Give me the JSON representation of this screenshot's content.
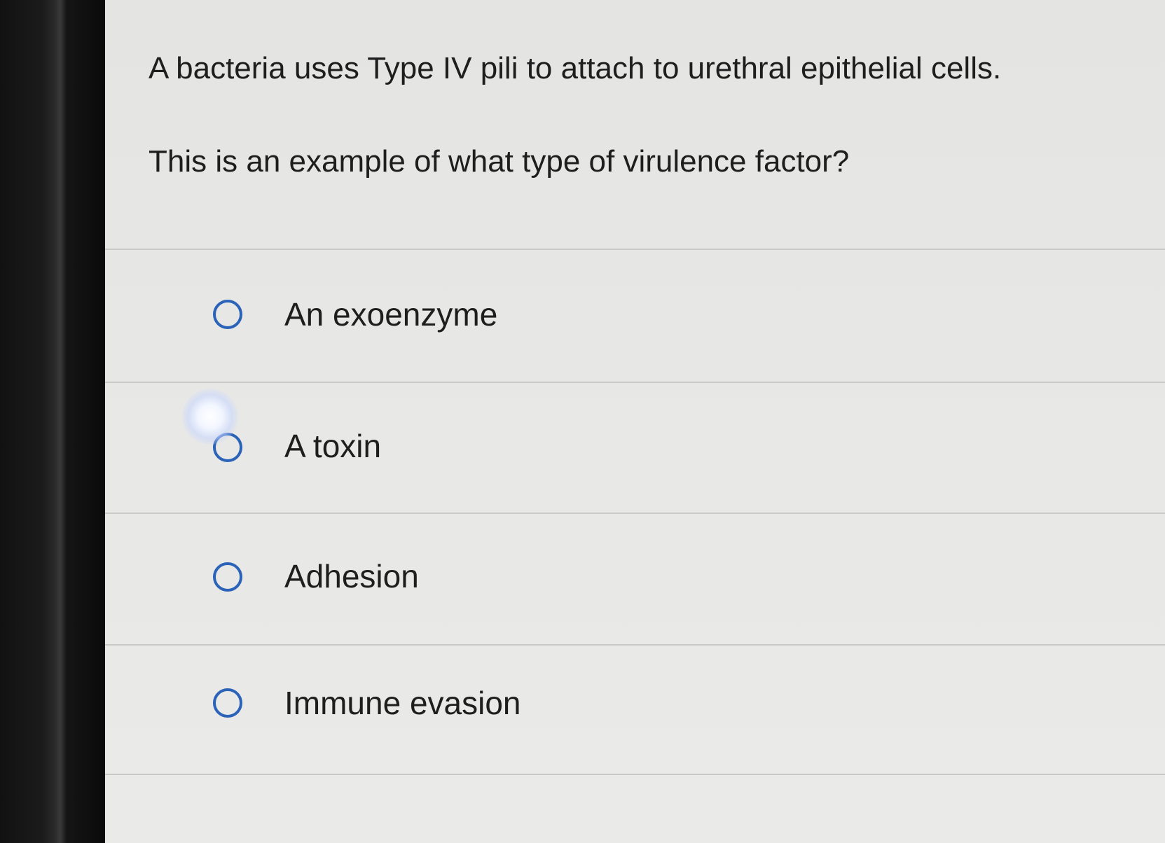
{
  "question": {
    "line1": "A bacteria uses Type IV pili to attach to urethral epithelial cells.",
    "line2": "This is an example of what type of virulence factor?"
  },
  "options": [
    {
      "label": "An exoenzyme",
      "selected": false
    },
    {
      "label": "A toxin",
      "selected": false
    },
    {
      "label": "Adhesion",
      "selected": false
    },
    {
      "label": "Immune evasion",
      "selected": false
    }
  ],
  "colors": {
    "radio_border": "#2b63b8",
    "background": "#e7e7e5",
    "text": "#1e1e1e"
  },
  "icons": {
    "radio": "radio-unchecked-icon"
  }
}
